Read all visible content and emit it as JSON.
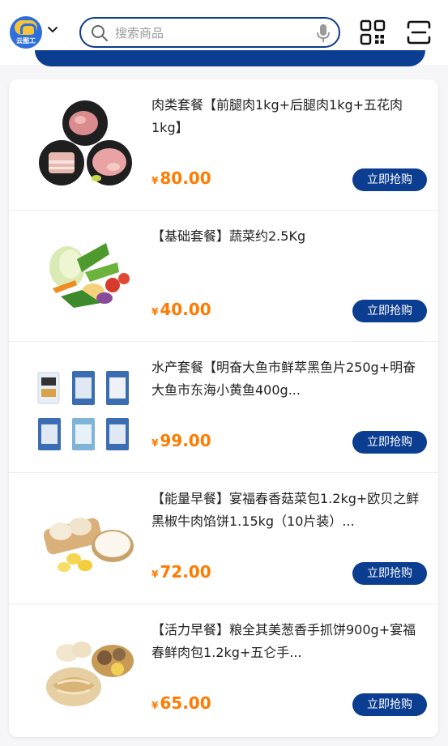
{
  "header": {
    "logo_text": "云图工",
    "search_placeholder": "搜索商品"
  },
  "products": [
    {
      "title": "肉类套餐【前腿肉1kg+后腿肉1kg+五花肉1kg】",
      "currency": "¥",
      "price": "80.00",
      "button": "立即抢购"
    },
    {
      "title": "【基础套餐】蔬菜约2.5Kg",
      "currency": "¥",
      "price": "40.00",
      "button": "立即抢购"
    },
    {
      "title": "水产套餐【明奋大鱼市鲜萃黑鱼片250g+明奋大鱼市东海小黄鱼400g...",
      "currency": "¥",
      "price": "99.00",
      "button": "立即抢购"
    },
    {
      "title": "【能量早餐】宴福春香菇菜包1.2kg+欧贝之鲜黑椒牛肉馅饼1.15kg（10片装）...",
      "currency": "¥",
      "price": "72.00",
      "button": "立即抢购"
    },
    {
      "title": "【活力早餐】粮全其美葱香手抓饼900g+宴福春鲜肉包1.2kg+五仑手...",
      "currency": "¥",
      "price": "65.00",
      "button": "立即抢购"
    }
  ],
  "colors": {
    "accent": "#0b3d91",
    "price": "#ff7a00"
  }
}
